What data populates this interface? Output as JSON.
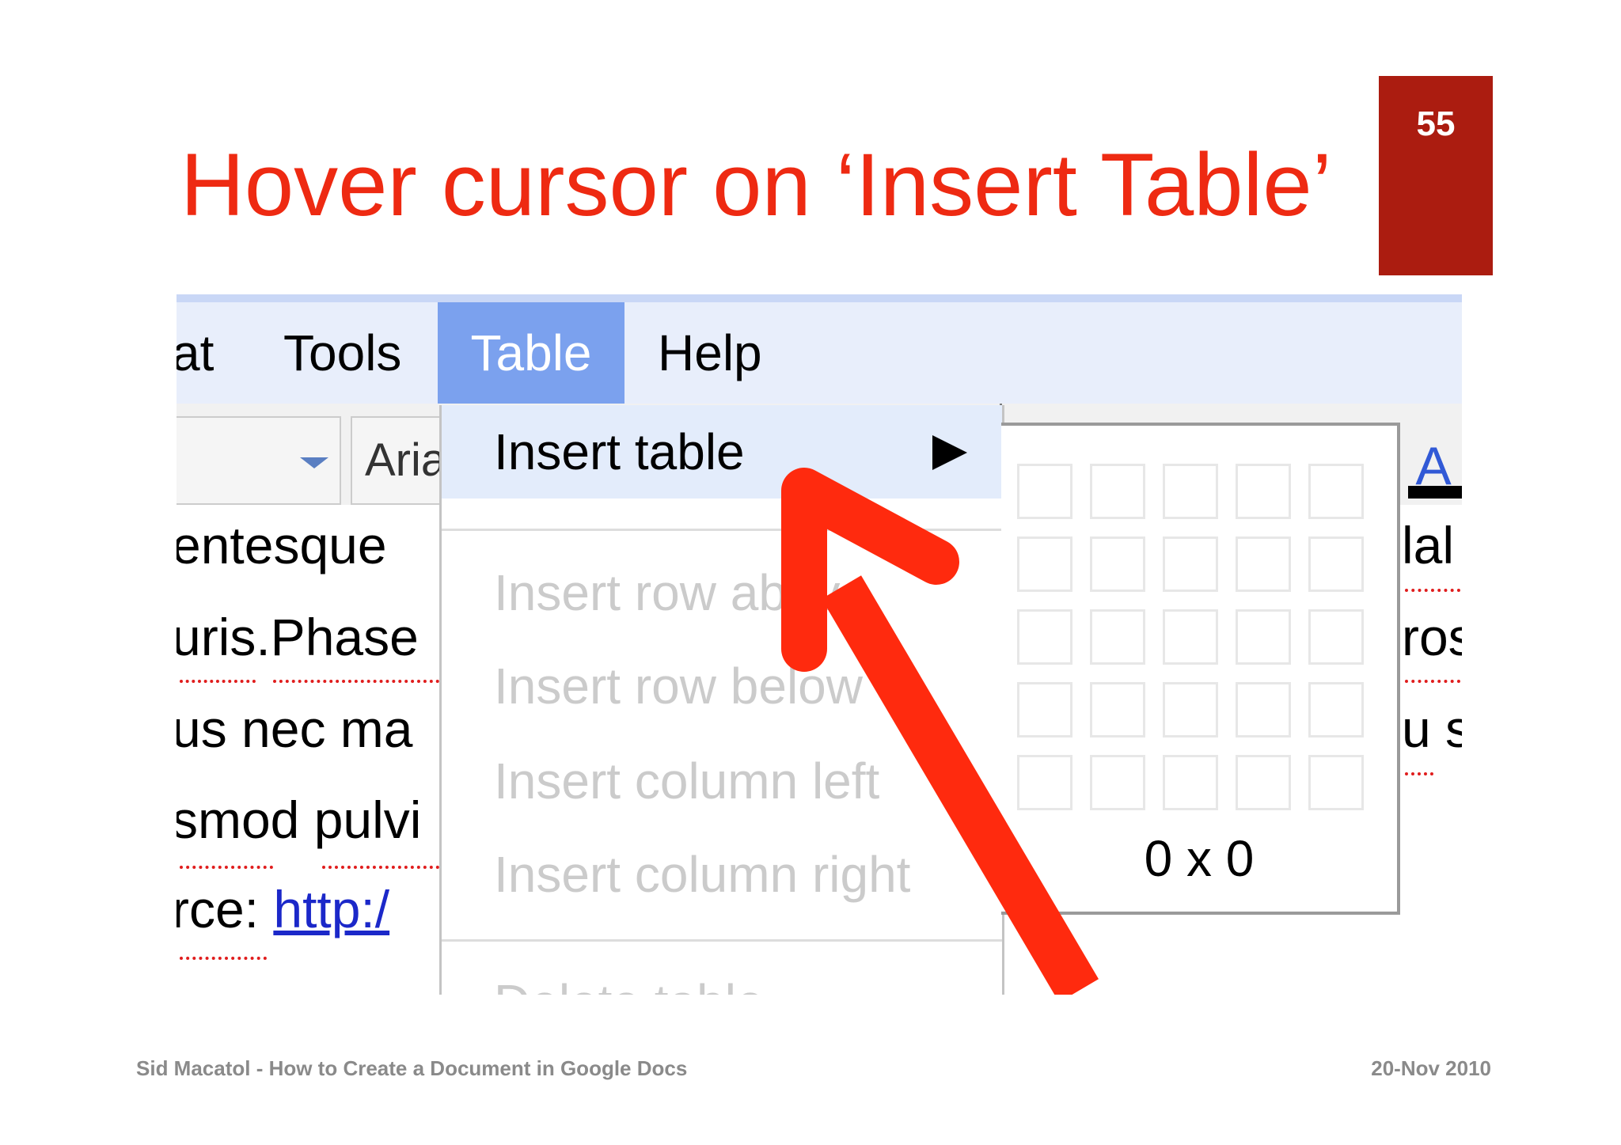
{
  "slide": {
    "title": "Hover cursor on ‘Insert Table’",
    "number": "55",
    "footer_left": "Sid Macatol - How to Create a Document in Google Docs",
    "footer_right": "20-Nov 2010"
  },
  "colors": {
    "title": "#ee2a12",
    "number_box": "#ab1c10",
    "menu_highlight": "#7ba1ee",
    "menubar": "#e8eefb",
    "arrow": "#ff2a0e"
  },
  "menubar": {
    "items": [
      "at",
      "Tools",
      "Table",
      "Help"
    ],
    "active": "Table"
  },
  "toolbar": {
    "font_label": "Aria",
    "text_color_icon": "text-color-icon"
  },
  "document": {
    "lines": [
      "entesque",
      "uris.Phase",
      "us nec ma",
      "smod pulvi"
    ],
    "source_prefix": "rce: ",
    "source_link": "http:/",
    "right_fragments": [
      "lal",
      "ros",
      "u s"
    ]
  },
  "table_menu": {
    "items": [
      {
        "label": "Insert table",
        "enabled": true,
        "highlighted": true
      },
      {
        "label": "Insert row above",
        "enabled": false
      },
      {
        "label": "Insert row below",
        "enabled": false
      },
      {
        "label": "Insert column left",
        "enabled": false
      },
      {
        "label": "Insert column right",
        "enabled": false
      },
      {
        "label": "Delete table",
        "enabled": false
      }
    ]
  },
  "table_grid": {
    "rows": 5,
    "columns": 5,
    "selection_label": "0 x 0"
  }
}
